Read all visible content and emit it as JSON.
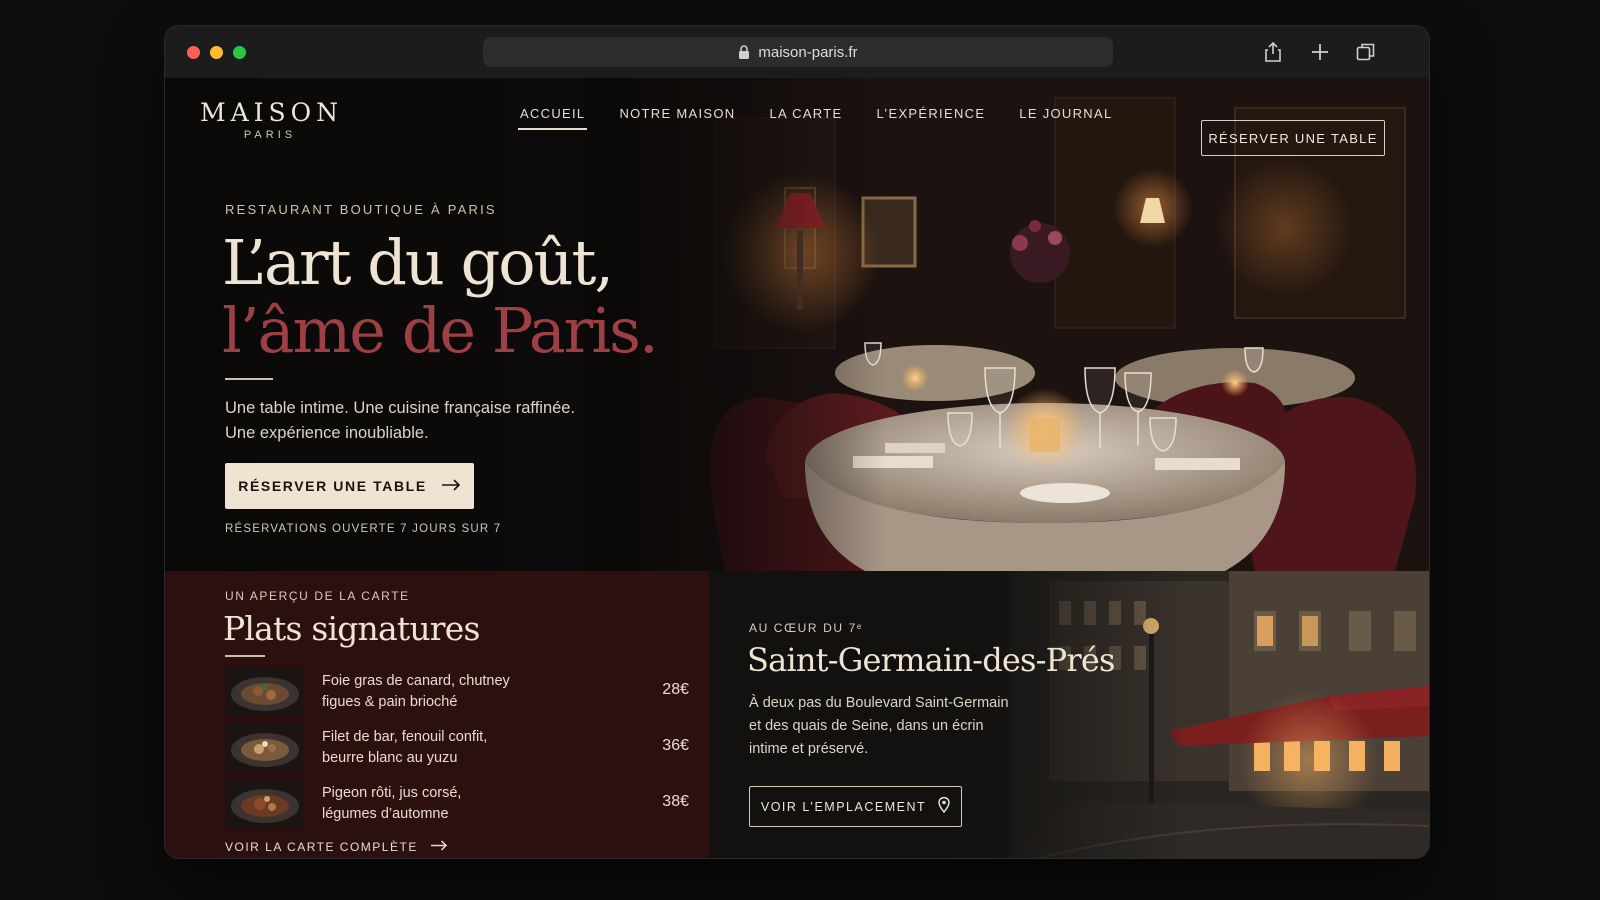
{
  "browser": {
    "url": "maison-paris.fr",
    "icons": [
      "lock-icon",
      "share-icon",
      "new-tab-icon",
      "tabs-overview-icon"
    ]
  },
  "brand": {
    "name": "MAISON",
    "sub": "PARIS"
  },
  "nav": {
    "items": [
      {
        "label": "ACCUEIL",
        "active": true
      },
      {
        "label": "NOTRE MAISON",
        "active": false
      },
      {
        "label": "LA CARTE",
        "active": false
      },
      {
        "label": "L’EXPÉRIENCE",
        "active": false
      },
      {
        "label": "LE JOURNAL",
        "active": false
      }
    ],
    "cta": "RÉSERVER UNE TABLE"
  },
  "hero": {
    "kicker": "RESTAURANT BOUTIQUE À PARIS",
    "headline_line1": "L’art du goût,",
    "headline_line2": "l’âme de Paris.",
    "desc_line1": "Une table intime. Une cuisine française raffinée.",
    "desc_line2": "Une expérience inoubliable.",
    "cta": "RÉSERVER UNE TABLE",
    "note": "RÉSERVATIONS OUVERTE 7 JOURS SUR 7"
  },
  "menu": {
    "kicker": "UN APERÇU DE LA CARTE",
    "title": "Plats signatures",
    "dishes": [
      {
        "line1": "Foie gras de canard, chutney",
        "line2": "figues & pain brioché",
        "price": "28€"
      },
      {
        "line1": "Filet de bar, fenouil confit,",
        "line2": "beurre blanc au yuzu",
        "price": "36€"
      },
      {
        "line1": "Pigeon rôti, jus corsé,",
        "line2": "légumes d’automne",
        "price": "38€"
      }
    ],
    "link": "VOIR LA CARTE COMPLÈTE"
  },
  "location": {
    "kicker": "AU CŒUR DU 7ᵉ",
    "title": "Saint-Germain-des-Prés",
    "desc_line1": "À deux pas du Boulevard Saint-Germain",
    "desc_line2": "et des quais de Seine, dans un écrin",
    "desc_line3": "intime et préservé.",
    "cta": "VOIR L’EMPLACEMENT"
  },
  "colors": {
    "accent_burgundy": "#9e3f45",
    "panel_burgundy": "#2c1010",
    "cream": "#efe3d1"
  }
}
